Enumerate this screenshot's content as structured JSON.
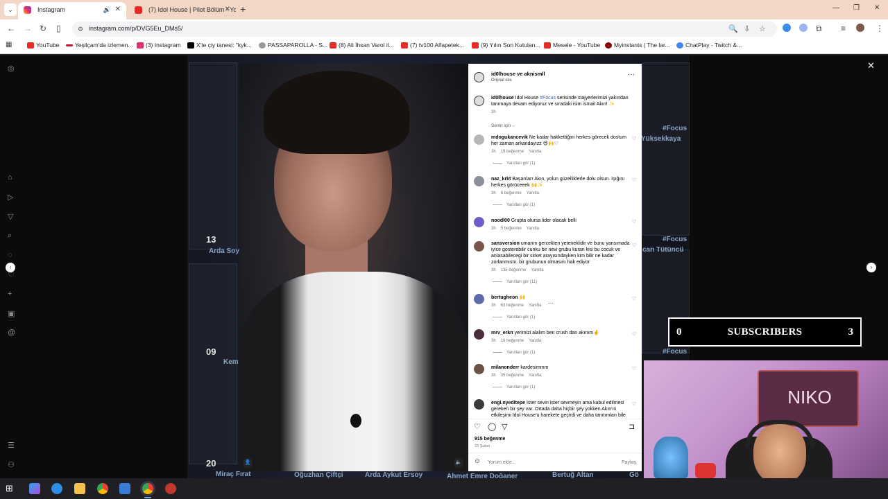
{
  "browser": {
    "tabs": [
      {
        "title": "Instagram",
        "active": true
      },
      {
        "title": "(7) Idol House | Pilot Bölüm - Yo",
        "active": false
      }
    ],
    "url": "instagram.com/p/DVG5Eu_DMs5/",
    "bookmarks": [
      {
        "label": "YouTube",
        "color": "#e52d27"
      },
      {
        "label": "Yeşilçam'da izlemen...",
        "color": "#c8102e"
      },
      {
        "label": "(3) Instagram",
        "color": "#e1306c"
      },
      {
        "label": "X'te çiy tanesi: \"kyk...",
        "color": "#000000"
      },
      {
        "label": "PASSAPAROLLA - S...",
        "color": "#888888"
      },
      {
        "label": "(8) Ali İhsan Varol il...",
        "color": "#e52d27"
      },
      {
        "label": "(7) tv100 Alfapetek...",
        "color": "#e52d27"
      },
      {
        "label": "(9) Yılın Son Kutuları...",
        "color": "#e52d27"
      },
      {
        "label": "Mesele - YouTube",
        "color": "#e52d27"
      },
      {
        "label": "Myinstants | The lar...",
        "color": "#8b0000"
      },
      {
        "label": "ChatPlay - Twitch &...",
        "color": "#4285f4"
      }
    ]
  },
  "backdrop": {
    "numbers": [
      "13",
      "09",
      "20"
    ],
    "names": [
      "Arda Soy",
      "Kem",
      "Miraç Fırat",
      "Oğuzhan Çiftçi",
      "Arda Aykut Ersoy",
      "Ahmet Emre Doğaner",
      "Bertuğ Altan",
      "Gö"
    ],
    "tags": [
      "#Focus",
      "Yüksekkaya",
      "#Focus",
      "can Tütüncü",
      "#Focus"
    ]
  },
  "post": {
    "header_user": "id0lhouse ve aknismll",
    "header_audio": "Orijinal ses",
    "caption_user": "id0lhouse",
    "caption_text": "Idol House",
    "caption_tag": "#Focus",
    "caption_rest": "serisinde stajyerlerimizi yakından tanımaya devam ediyoruz ve sıradaki isim ismail Akın! ✨",
    "caption_time": "3h",
    "sort_label": "Senin için ⌵",
    "comments": [
      {
        "user": "mdogukancevik",
        "text": "Ne kadar hakkettiğini herkes görecek dostum her zaman arkandayızz 😍🙌♡",
        "time": "3h",
        "likes": "19 beğenme",
        "reply": "Yanıtla",
        "replies": "Yanıtları gör (1)"
      },
      {
        "user": "naz_krkt",
        "text": "Başarılarr Akın, yolun güzelliklerle dolu olsun. Işığını herkes görüceeek 🙌✨",
        "time": "3h",
        "likes": "6 beğenme",
        "reply": "Yanıtla",
        "replies": "Yanıtları gör (1)"
      },
      {
        "user": "noodl00",
        "text": "Grupta olursa lider olacak belli",
        "time": "3h",
        "likes": "5 beğenme",
        "reply": "Yanıtla",
        "replies": ""
      },
      {
        "user": "sansversion",
        "text": "umarım gercekten yeteneklidir ve bunu yansımada iyice gosterebilir cunku bir nevi grubu kuran kisi bu cocuk ve anlasabilecegi bir sirket arayısındayken kim bilir ne kadar zorlanmıstır. bir grubunun olmasını hak ediyor",
        "time": "3h",
        "likes": "135 beğenme",
        "reply": "Yanıtla",
        "replies": "Yanıtları gör (11)"
      },
      {
        "user": "bertugheon",
        "text": "🙌",
        "time": "3h",
        "likes": "63 beğenme",
        "reply": "Yanıtla",
        "replies": "Yanıtları gör (1)"
      },
      {
        "user": "mrv_erkn",
        "text": "yerimizi alalım ben crush dan akınım🤞",
        "time": "3h",
        "likes": "16 beğenme",
        "reply": "Yanıtla",
        "replies": "Yanıtları gör (1)"
      },
      {
        "user": "milanonderr",
        "text": "kardesimmm",
        "time": "3h",
        "likes": "35 beğenme",
        "reply": "Yanıtla",
        "replies": "Yanıtları gör (1)"
      },
      {
        "user": "engi.nyeditepe",
        "text": "İster sevin ister sevmeyin ama kabul edilmesi gereken bir şey var. Ortada daha hiçbir şey yokken Akın'ın etkileşimi Idol House'u harekete geçirdi ve daha tanıtımları bile",
        "time": "",
        "likes": "",
        "reply": "",
        "replies": ""
      }
    ],
    "likes_total": "915 beğenme",
    "date": "23 Şubat",
    "comment_placeholder": "Yorum ekle...",
    "share_label": "Paylaş"
  },
  "overlay": {
    "subs_left": "0",
    "subs_label": "SUBSCRIBERS",
    "subs_right": "3",
    "neon_sign": "NIKO"
  },
  "icons": {
    "side": [
      "instagram-icon",
      "home-icon",
      "reels-icon",
      "send-icon",
      "search-icon",
      "explore-icon",
      "notifications-icon",
      "add-icon",
      "profile-icon",
      "threads-icon",
      "menu-icon",
      "more-icon"
    ]
  }
}
